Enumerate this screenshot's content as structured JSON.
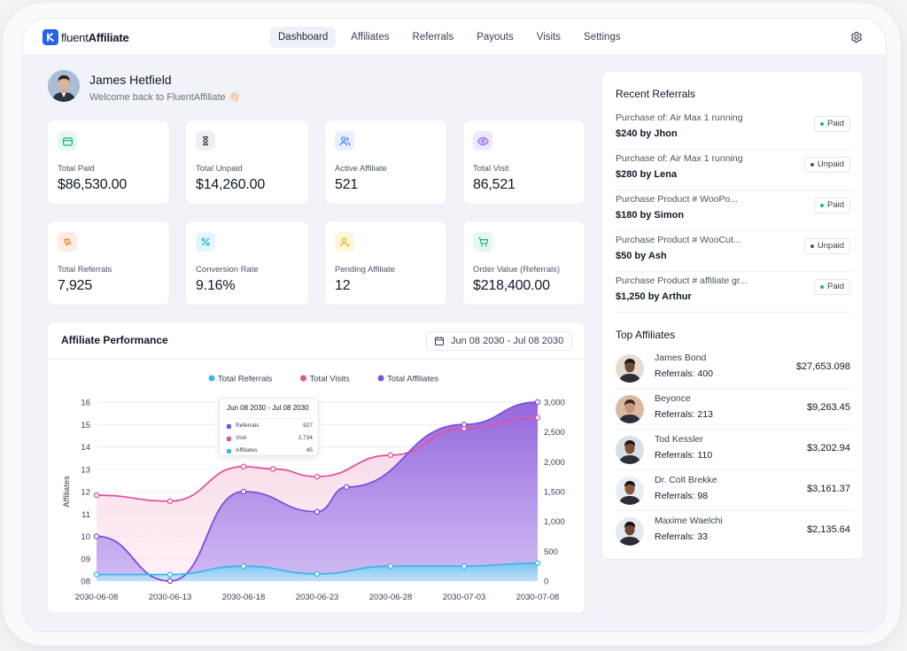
{
  "brand": {
    "light": "fluent",
    "bold": "Affiliate"
  },
  "nav": [
    {
      "label": "Dashboard",
      "active": true
    },
    {
      "label": "Affiliates"
    },
    {
      "label": "Referrals"
    },
    {
      "label": "Payouts"
    },
    {
      "label": "Visits"
    },
    {
      "label": "Settings"
    }
  ],
  "icons": {
    "settings": "gear-icon"
  },
  "user": {
    "name": "James Hetfield",
    "welcome": "Welcome back to FluentAffiliate 👋🏻"
  },
  "stats": [
    {
      "label": "Total Paid",
      "value": "$86,530.00",
      "icon": "wallet-icon",
      "color": "#10b981",
      "bg": "#e7f8f0"
    },
    {
      "label": "Total Unpaid",
      "value": "$14,260.00",
      "icon": "hourglass-icon",
      "color": "#374151",
      "bg": "#eef0f3"
    },
    {
      "label": "Active Affiliate",
      "value": "521",
      "icon": "users-icon",
      "color": "#3b82f6",
      "bg": "#e8efff"
    },
    {
      "label": "Total Visit",
      "value": "86,521",
      "icon": "eye-icon",
      "color": "#8b5cf6",
      "bg": "#efe9ff"
    },
    {
      "label": "Total Referrals",
      "value": "7,925",
      "icon": "referral-icon",
      "color": "#f97316",
      "bg": "#fdece4"
    },
    {
      "label": "Conversion Rate",
      "value": "9.16%",
      "icon": "percent-icon",
      "color": "#06b6d4",
      "bg": "#e3f6fa"
    },
    {
      "label": "Pending Affiliate",
      "value": "12",
      "icon": "user-pending-icon",
      "color": "#eab308",
      "bg": "#fdf6dc"
    },
    {
      "label": "Order Value (Referrals)",
      "value": "$218,400.00",
      "icon": "cart-icon",
      "color": "#10b981",
      "bg": "#e6f7ef"
    }
  ],
  "performance": {
    "title": "Affiliate Performance",
    "date_range": "Jun 08 2030 - Jul 08 2030",
    "tooltip": {
      "title": "Jun 08 2030 - Jul 08 2030",
      "rows": [
        {
          "label": "Referrals",
          "value": "927"
        },
        {
          "label": "Visit",
          "value": "2,734"
        },
        {
          "label": "Affiliates",
          "value": "45"
        }
      ]
    }
  },
  "chart_data": {
    "type": "area",
    "x": [
      "2030-06-08",
      "2030-06-13",
      "2030-06-18",
      "2030-06-23",
      "2030-06-28",
      "2030-07-03",
      "2030-07-08"
    ],
    "ylabel": "Affiliates",
    "y_left_ticks": [
      "16",
      "15",
      "14",
      "13",
      "12",
      "11",
      "10",
      "09",
      "08"
    ],
    "y_right_ticks": [
      "3,000",
      "2,500",
      "2,000",
      "1,500",
      "1,000",
      "500",
      "0"
    ],
    "ylim_left": [
      8,
      16
    ],
    "ylim_right": [
      0,
      3000
    ],
    "legend_position": "top-center",
    "series": [
      {
        "name": "Total Referrals",
        "color": "#3eb6ec",
        "axis": "right",
        "x": [
          "2030-06-08",
          "2030-06-13",
          "2030-06-18",
          "2030-06-23",
          "2030-06-28",
          "2030-07-03",
          "2030-07-08"
        ],
        "values": [
          110,
          110,
          250,
          120,
          250,
          250,
          300
        ]
      },
      {
        "name": "Total Visits",
        "color": "#e0559e",
        "axis": "right",
        "x": [
          "2030-06-08",
          "2030-06-13",
          "2030-06-18",
          "2030-06-20",
          "2030-06-23",
          "2030-06-28",
          "2030-07-03",
          "2030-07-08"
        ],
        "values": [
          1440,
          1340,
          1920,
          1880,
          1750,
          2110,
          2560,
          2740
        ]
      },
      {
        "name": "Total Affiliates",
        "color": "#7b4fd8",
        "axis": "left",
        "x": [
          "2030-06-08",
          "2030-06-13",
          "2030-06-18",
          "2030-06-23",
          "2030-06-25",
          "2030-07-03",
          "2030-07-08"
        ],
        "values": [
          10,
          8,
          12,
          11.1,
          12.2,
          15,
          16
        ]
      }
    ]
  },
  "recent_referrals": {
    "title": "Recent Referrals",
    "items": [
      {
        "desc": "Purchase of: Air Max 1 running",
        "amount": "$240 by Jhon",
        "status": "Paid"
      },
      {
        "desc": "Purchase of: Air Max 1 running",
        "amount": "$280 by Lena",
        "status": "Unpaid"
      },
      {
        "desc": "Purchase Product # WooPo...",
        "amount": "$180 by Simon",
        "status": "Paid"
      },
      {
        "desc": "Purchase Product # WooCut...",
        "amount": "$50 by Ash",
        "status": "Unpaid"
      },
      {
        "desc": "Purchase Product # affiliate gr...",
        "amount": "$1,250 by Arthur",
        "status": "Paid"
      }
    ]
  },
  "top_affiliates": {
    "title": "Top Affiliates",
    "items": [
      {
        "name": "James Bond",
        "referrals": "Referrals: 400",
        "amount": "$27,653.098",
        "skin": "#6b4a35",
        "bg": "#e7dcd2",
        "hair": "#1f1712"
      },
      {
        "name": "Beyonce",
        "referrals": "Referrals: 213",
        "amount": "$9,263.45",
        "skin": "#c79474",
        "bg": "#d9b9a4",
        "hair": "#3b2618"
      },
      {
        "name": "Tod Kessler",
        "referrals": "Referrals: 110",
        "amount": "$3,202.94",
        "skin": "#7a5239",
        "bg": "#d8e0e7",
        "hair": "#201813"
      },
      {
        "name": "Dr. Colt Brekke",
        "referrals": "Referrals: 98",
        "amount": "$3,161.37",
        "skin": "#8a5a3e",
        "bg": "#e9eef4",
        "hair": "#1b120d"
      },
      {
        "name": "Maxime Waelchi",
        "referrals": "Referrals: 33",
        "amount": "$2,135.64",
        "skin": "#6e4633",
        "bg": "#e6e9ef",
        "hair": "#15100c"
      }
    ]
  }
}
